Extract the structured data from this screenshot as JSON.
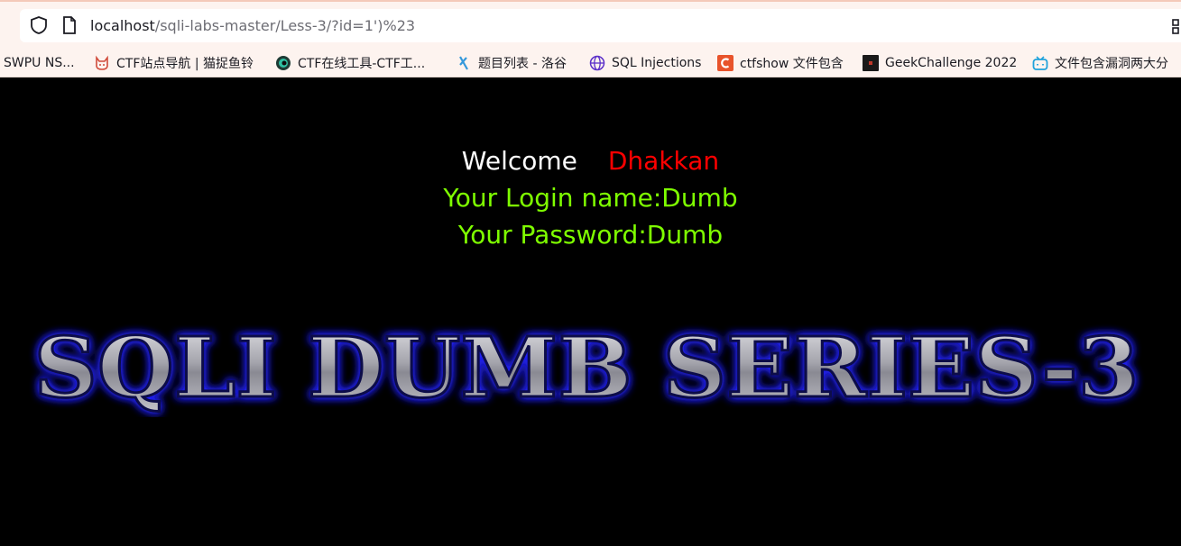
{
  "browser": {
    "url_host": "localhost",
    "url_rest": "/sqli-labs-master/Less-3/?id=1')%23",
    "bookmarks": [
      {
        "label": "SWPU NS...",
        "icon": "none"
      },
      {
        "label": "CTF站点导航 | 猫捉鱼铃",
        "icon": "cat-face-icon"
      },
      {
        "label": "CTF在线工具-CTF工...",
        "icon": "ctf-eye-icon"
      },
      {
        "label": "题目列表 - 洛谷",
        "icon": "luogu-icon"
      },
      {
        "label": "SQL Injections",
        "icon": "globe-icon"
      },
      {
        "label": "ctfshow 文件包含",
        "icon": "ctfshow-c-icon"
      },
      {
        "label": "GeekChallenge 2022",
        "icon": "geek-icon"
      },
      {
        "label": "文件包含漏洞两大分",
        "icon": "bilibili-tv-icon"
      }
    ]
  },
  "page": {
    "welcome_label": "Welcome",
    "welcome_name": "Dhakkan",
    "login_line": "Your Login name:Dumb",
    "password_line": "Your Password:Dumb",
    "banner_text": "SQLI DUMB SERIES-3",
    "colors": {
      "background": "#000000",
      "welcome": "#ffffff",
      "name": "#ff0000",
      "result": "#7fff00",
      "banner_glow": "#1a1aff"
    }
  }
}
